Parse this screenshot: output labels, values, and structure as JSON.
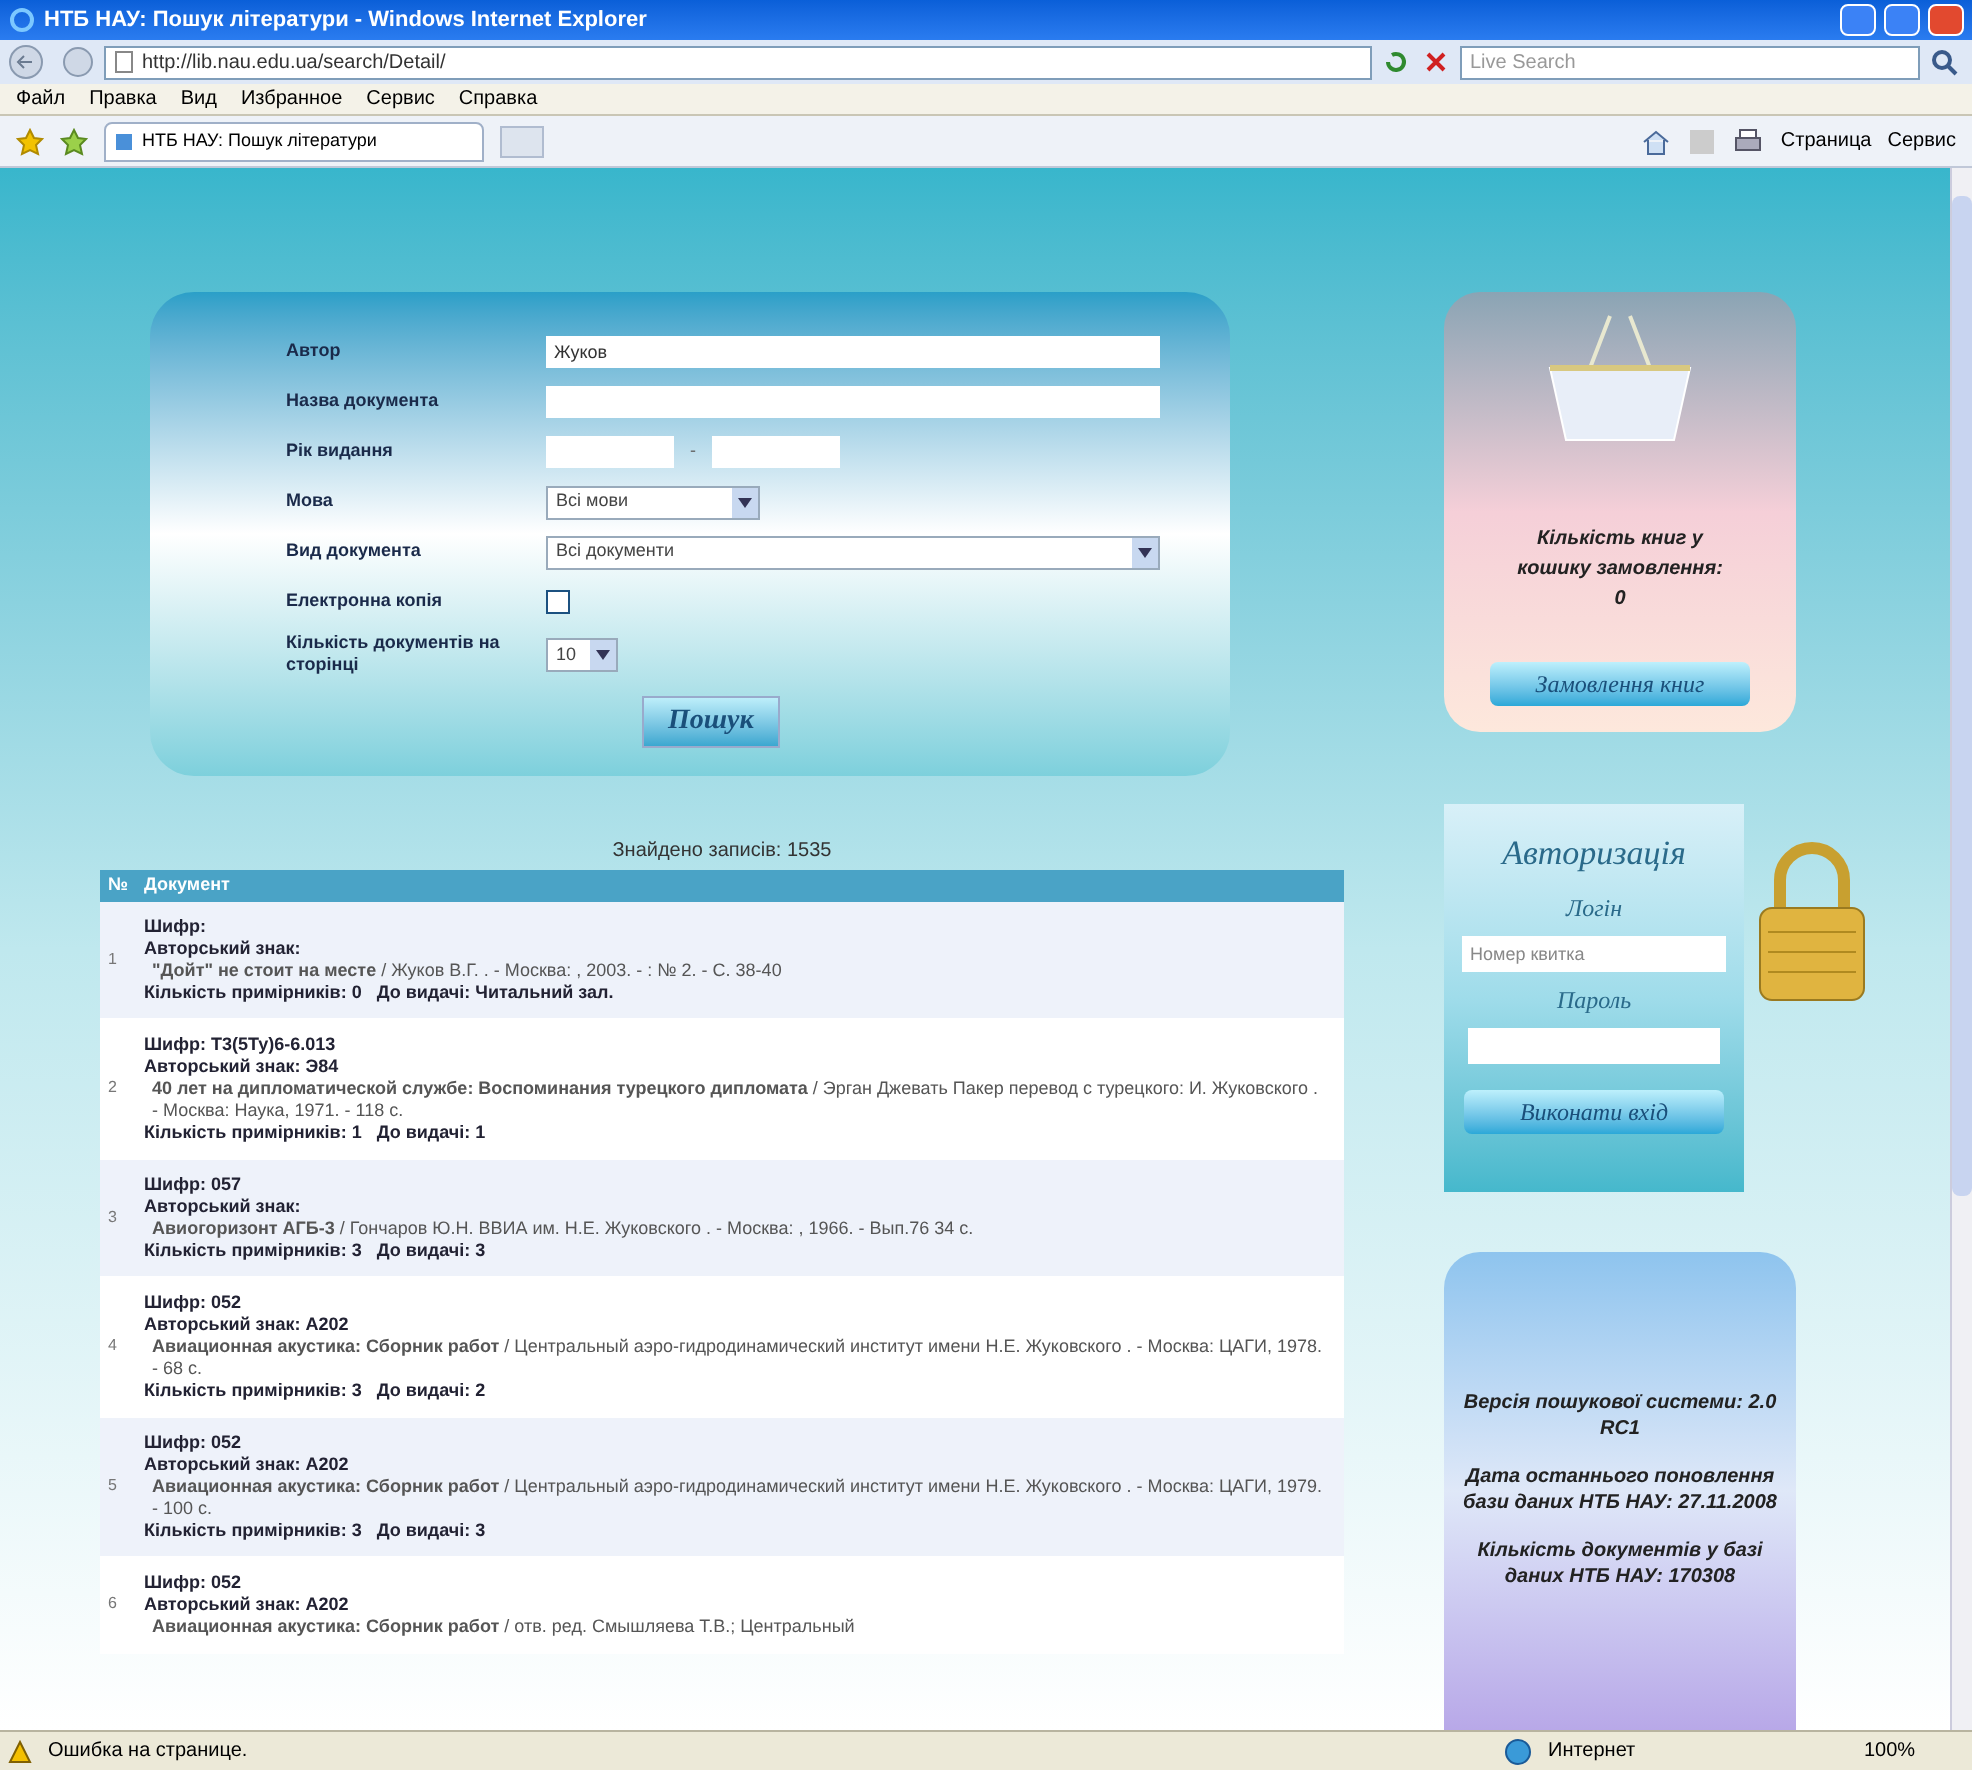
{
  "window": {
    "title": "НТБ НАУ: Пошук літератури - Windows Internet Explorer"
  },
  "address_bar": {
    "url": "http://lib.nau.edu.ua/search/Detail/"
  },
  "search_field": {
    "placeholder": "Live Search"
  },
  "menu": [
    "Файл",
    "Правка",
    "Вид",
    "Избранное",
    "Сервис",
    "Справка"
  ],
  "tab": {
    "title": "НТБ НАУ: Пошук літератури"
  },
  "command_bar": [
    "Страница",
    "Сервис"
  ],
  "search_form": {
    "fields": [
      {
        "kind": "text",
        "label": "Автор",
        "value": "Жуков"
      },
      {
        "kind": "text",
        "label": "Назва документа"
      },
      {
        "kind": "range",
        "label": "Рік видання",
        "separator": "-"
      },
      {
        "kind": "select",
        "label": "Мова",
        "value": "Всі мови"
      },
      {
        "kind": "select_wide",
        "label": "Вид документа",
        "value": "Всі документи"
      },
      {
        "kind": "checkbox",
        "label": "Електронна копія",
        "checked": false
      },
      {
        "kind": "select_small",
        "label": "Кількість документів на сторінці",
        "value": "10"
      }
    ],
    "button": "Пошук"
  },
  "results": {
    "count": "Знайдено записів: 1535",
    "columns": [
      "№",
      "Документ"
    ],
    "rows": [
      {
        "number": "1",
        "shelf": "Шифр:",
        "mark": "Авторський знак:",
        "description": "**\"Дойт\" не стоит на месте** / Жуков В.Г. . - Москва: , 2003. - : № 2. - С. 38-40",
        "copies": "Кількість примірників: 0   До видачі: Читальний зал."
      },
      {
        "number": "2",
        "shelf": "Шифр: Т3(5Ту)6-6.013",
        "mark": "Авторський знак: Э84",
        "description": "**40 лет на дипломатической службе: Воспоминания турецкого дипломата** / Эрган Джевать Пакер перевод с турецкого: И. Жуковского . - Москва: Наука, 1971. - 118 с.",
        "copies": "Кількість примірників: 1   До видачі: 1"
      },
      {
        "number": "3",
        "shelf": "Шифр: 057",
        "mark": "Авторський знак:",
        "description": "**Авиогоризонт АГБ-3** / Гончаров Ю.Н. ВВИА им. Н.Е. Жуковского . - Москва: , 1966. - Вып.76 34 с.",
        "copies": "Кількість примірників: 3   До видачі: 3"
      },
      {
        "number": "4",
        "shelf": "Шифр: 052",
        "mark": "Авторський знак: А202",
        "description": "**Авиационная акустика: Сборник работ** / Центральный аэро-гидродинамический институт имени Н.Е. Жуковского . - Москва: ЦАГИ, 1978. - 68 с.",
        "copies": "Кількість примірників: 3   До видачі: 2"
      },
      {
        "number": "5",
        "shelf": "Шифр: 052",
        "mark": "Авторський знак: А202",
        "description": "**Авиационная акустика: Сборник работ** / Центральный аэро-гидродинамический институт имени Н.Е. Жуковского . - Москва: ЦАГИ, 1979. - 100 с.",
        "copies": "Кількість примірників: 3   До видачі: 3"
      },
      {
        "number": "6",
        "shelf": "Шифр: 052",
        "mark": "Авторський знак: А202",
        "description": "**Авиационная акустика: Сборник работ** / отв. ред. Смышляева Т.В.; Центральный"
      }
    ]
  },
  "basket": {
    "text": "Кількість книг у кошику замовлення: 0",
    "button": "Замовлення книг"
  },
  "login": {
    "title": "Авторизація",
    "login_label": "Логін",
    "login_placeholder": "Номер квитка",
    "password_label": "Пароль",
    "button": "Виконати вхід"
  },
  "info": [
    "Версія пошукової системи: 2.0 RC1",
    "Дата останнього поновлення бази даних НТБ НАУ: 27.11.2008",
    "Кількість документів у базі даних НТБ НАУ: 170308"
  ],
  "status_bar": {
    "message": "Ошибка на странице.",
    "zone": "Интернет",
    "zoom": "100%"
  }
}
